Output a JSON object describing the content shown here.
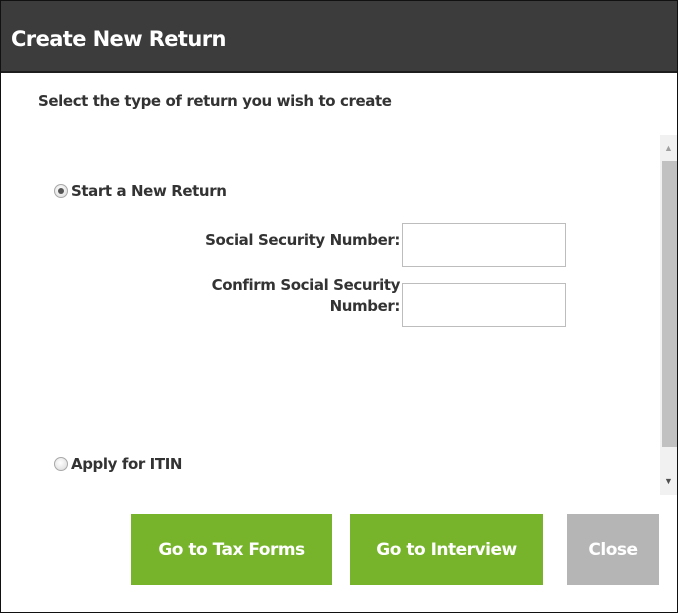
{
  "dialog": {
    "title": "Create New Return",
    "subtitle": "Select the type of return you wish to create"
  },
  "options": {
    "new_return": {
      "label": "Start a New Return",
      "selected": true
    },
    "itin": {
      "label": "Apply for ITIN",
      "selected": false
    }
  },
  "fields": {
    "ssn": {
      "label": "Social Security Number:",
      "value": ""
    },
    "confirm_ssn": {
      "label_line1": "Confirm Social Security",
      "label_line2": "Number:",
      "value": ""
    }
  },
  "buttons": {
    "tax_forms": "Go to Tax Forms",
    "interview": "Go to Interview",
    "close": "Close"
  },
  "colors": {
    "titlebar": "#3c3c3c",
    "primary_button": "#77b42b",
    "secondary_button": "#b5b5b5"
  },
  "icons": {
    "scroll_up": "scroll-up-arrow-icon",
    "scroll_down": "scroll-down-arrow-icon"
  }
}
